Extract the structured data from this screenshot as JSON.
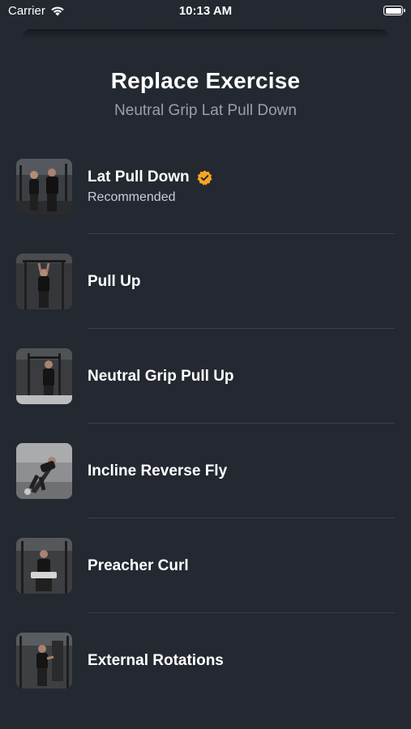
{
  "status_bar": {
    "carrier": "Carrier",
    "time": "10:13 AM"
  },
  "header": {
    "title": "Replace Exercise",
    "subtitle": "Neutral Grip Lat Pull Down"
  },
  "colors": {
    "background": "#242830",
    "verified_badge": "#F5A623",
    "subtitle_text": "#9aa0aa",
    "divider": "#3a3f49"
  },
  "exercises": [
    {
      "name": "Lat Pull Down",
      "subtitle": "Recommended",
      "badge_icon": "verified-check-icon"
    },
    {
      "name": "Pull Up"
    },
    {
      "name": "Neutral Grip Pull Up"
    },
    {
      "name": "Incline Reverse Fly"
    },
    {
      "name": "Preacher Curl"
    },
    {
      "name": "External Rotations"
    }
  ]
}
